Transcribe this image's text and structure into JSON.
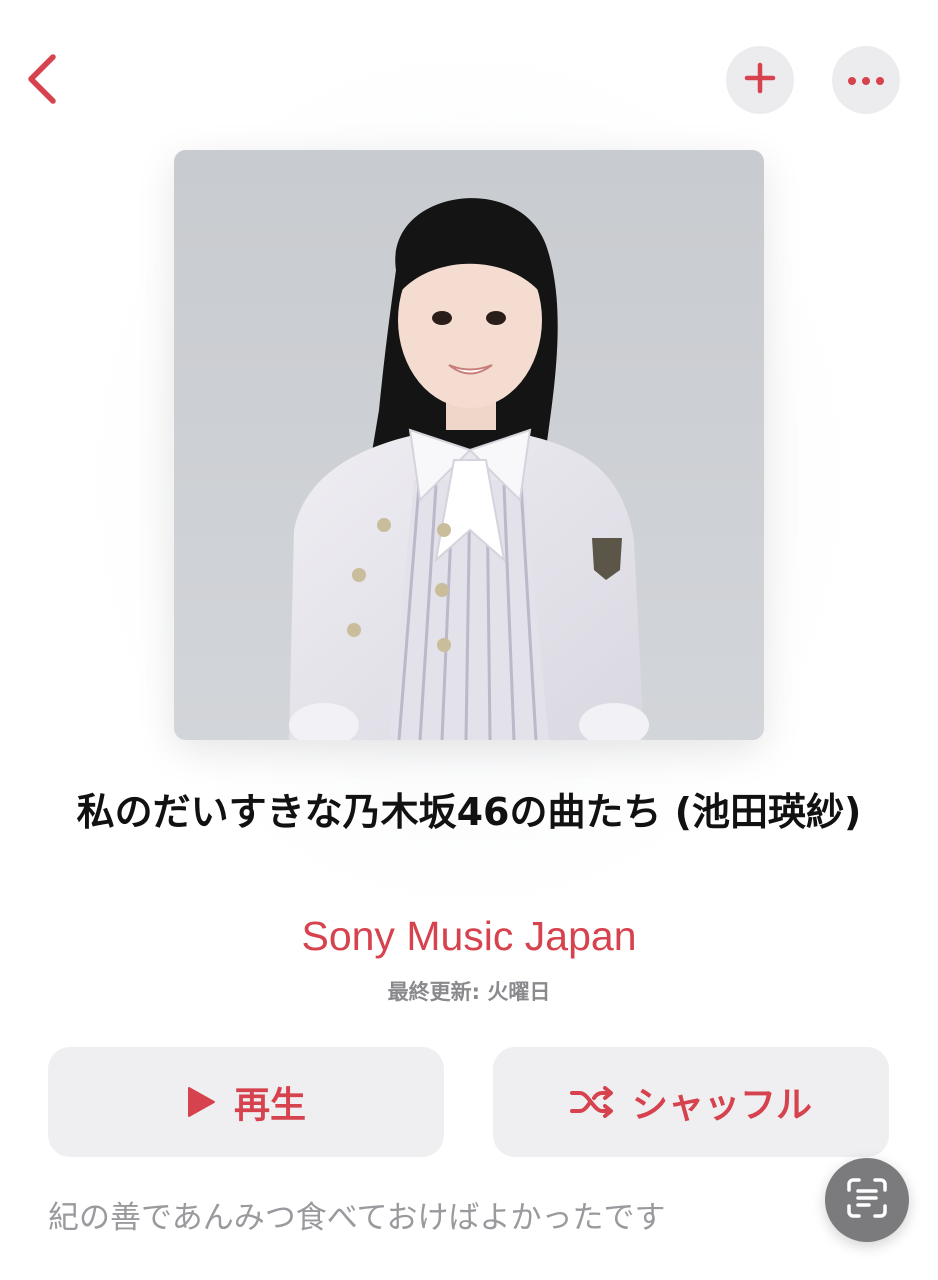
{
  "nav": {
    "back_icon": "chevron-left-icon",
    "add_icon": "plus-icon",
    "more_icon": "ellipsis-icon"
  },
  "artwork": {
    "description_icon": "playlist-cover-portrait"
  },
  "playlist": {
    "title": "私のだいすきな乃木坂46の曲たち (池田瑛紗)",
    "curator": "Sony Music Japan",
    "updated": "最終更新: 火曜日"
  },
  "actions": {
    "play_label": "再生",
    "shuffle_label": "シャッフル"
  },
  "description": {
    "text": "紀の善であんみつ食べておけばよかったです"
  },
  "colors": {
    "accent": "#d6424d",
    "button_bg": "#efeff1",
    "secondary_text": "#8a8a8e"
  }
}
